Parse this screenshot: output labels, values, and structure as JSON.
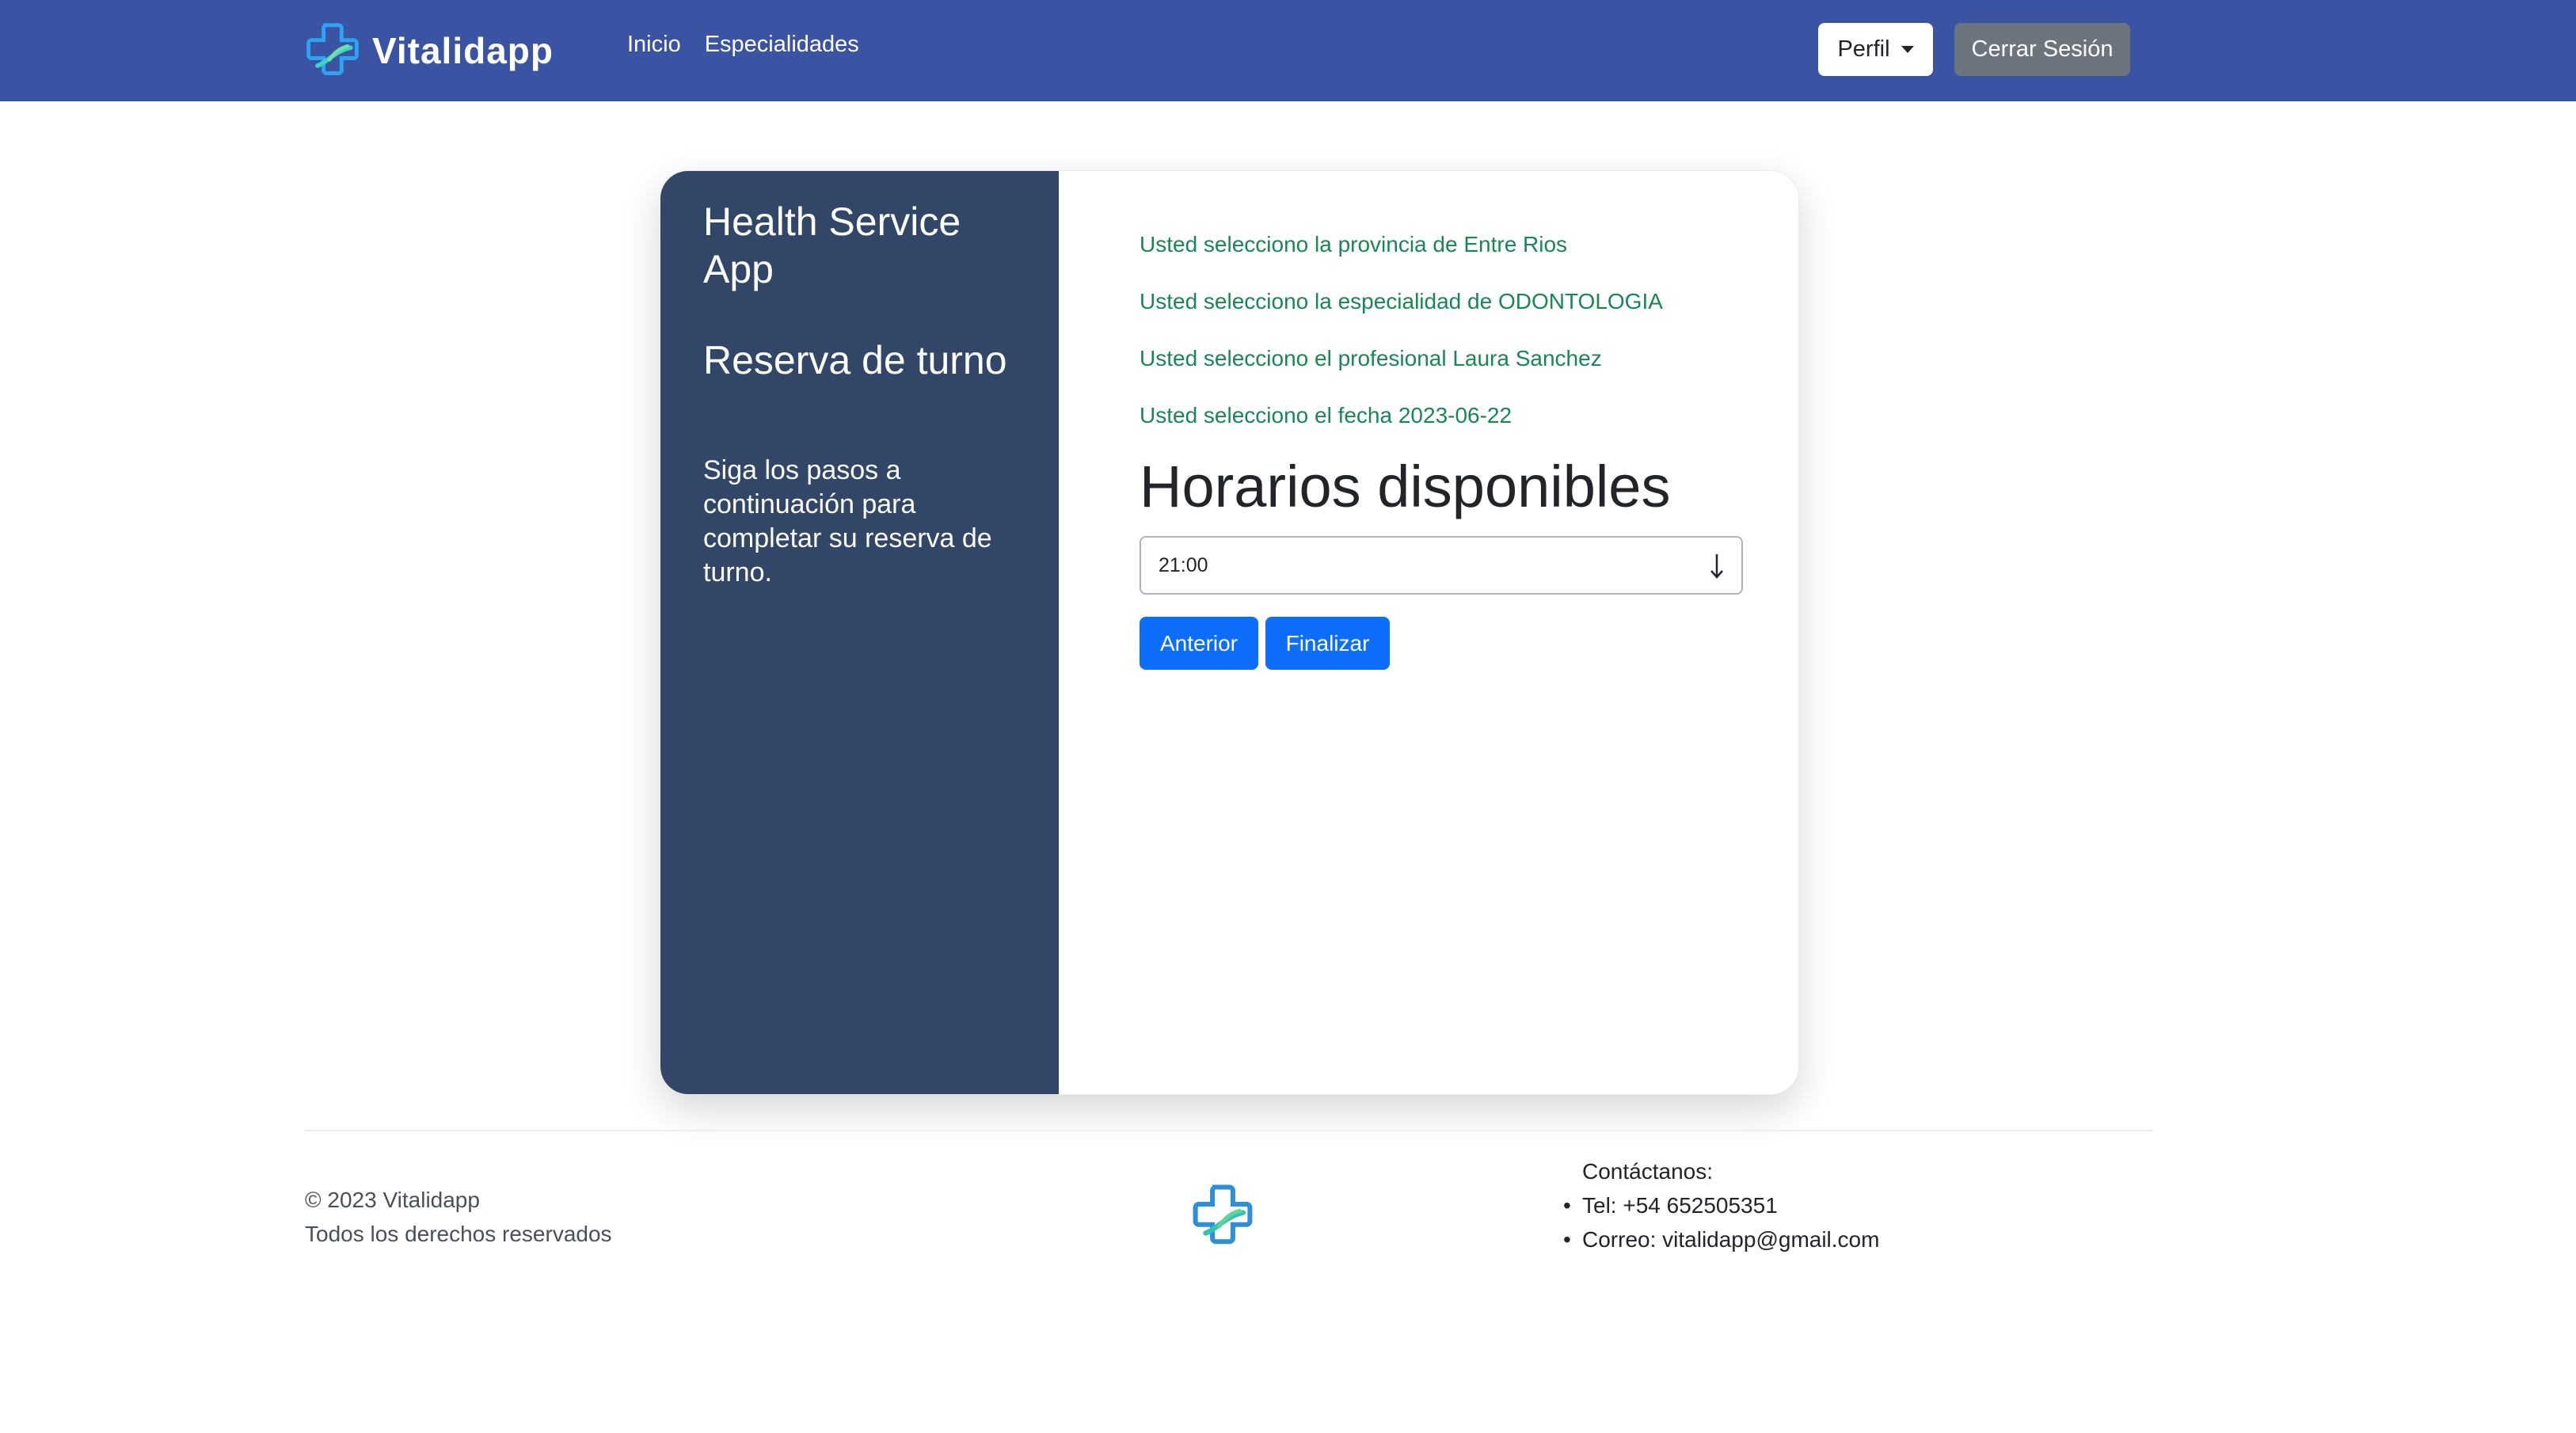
{
  "navbar": {
    "brand": "Vitalidapp",
    "links": [
      "Inicio",
      "Especialidades"
    ],
    "perfil_label": "Perfil",
    "logout_label": "Cerrar Sesión",
    "background_color": "#3b53a3"
  },
  "sidebar": {
    "app_name": "Health Service App",
    "title": "Reserva de turno",
    "description": "Siga los pasos a continuación para completar su reserva de turno."
  },
  "summary": [
    "Usted selecciono la provincia de Entre Rios",
    "Usted selecciono la especialidad de ODONTOLOGIA",
    "Usted selecciono el profesional Laura Sanchez",
    "Usted selecciono el fecha 2023-06-22"
  ],
  "schedule": {
    "heading": "Horarios disponibles",
    "selected_time": "21:00"
  },
  "actions": {
    "prev_label": "Anterior",
    "finish_label": "Finalizar"
  },
  "footer": {
    "copyright": "© 2023 Vitalidapp",
    "rights": "Todos los derechos reservados",
    "contact_title": "Contáctanos:",
    "contact_items": [
      "Tel: +54 652505351",
      "Correo: vitalidapp@gmail.com"
    ]
  },
  "colors": {
    "sidebar": "#324767",
    "summary_text": "#198754",
    "primary_button": "#0d6efd",
    "secondary_button": "#6c757d"
  },
  "icons": {
    "brand": "medical-cross-icon",
    "select": "arrow-down-icon",
    "footer": "medical-cross-icon"
  }
}
